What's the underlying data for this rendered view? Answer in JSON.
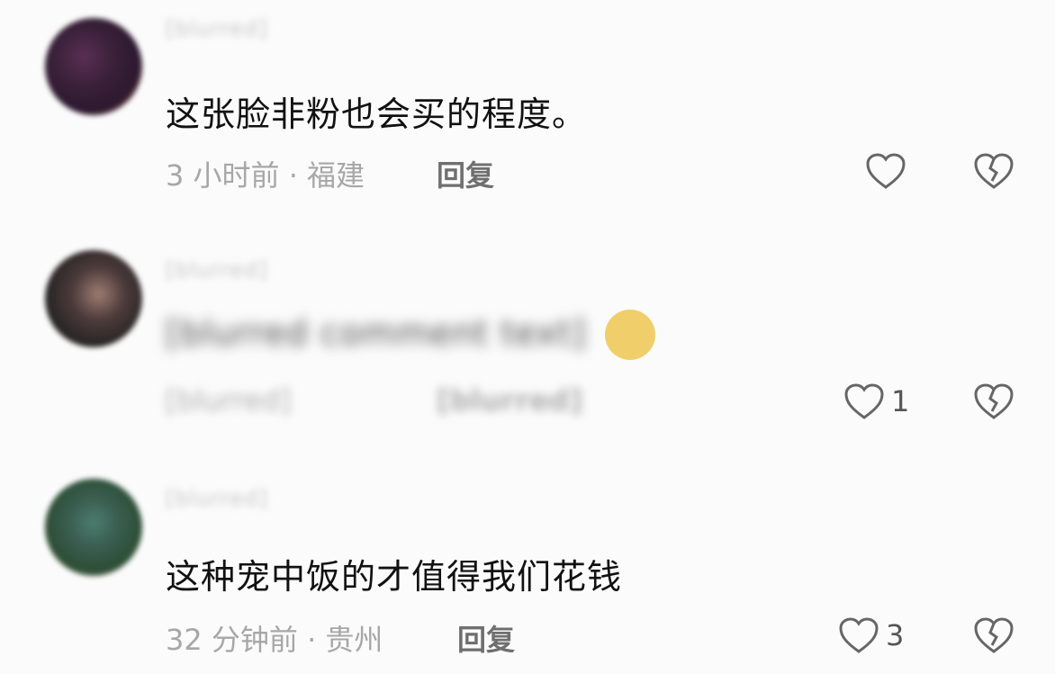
{
  "comments": [
    {
      "username": "[blurred]",
      "text": "这张脸非粉也会买的程度。",
      "meta": "3 小时前 · 福建",
      "reply_label": "回复",
      "like_count": "",
      "avatar_icon": "avatar-photo"
    },
    {
      "username": "[blurred]",
      "text": "[blurred comment text]",
      "meta": "[blurred]",
      "reply_label": "[blurred]",
      "like_count": "1",
      "avatar_icon": "avatar-photo"
    },
    {
      "username": "[blurred]",
      "text": "这种宠中饭的才值得我们花钱",
      "meta": "32 分钟前 · 贵州",
      "reply_label": "回复",
      "like_count": "3",
      "avatar_icon": "avatar-photo"
    }
  ],
  "icons": {
    "like": "heart-outline-icon",
    "dislike": "broken-heart-icon"
  },
  "colors": {
    "background": "#fbfbfb",
    "text": "#111111",
    "meta": "#a7a7a7",
    "icon": "#666666"
  }
}
